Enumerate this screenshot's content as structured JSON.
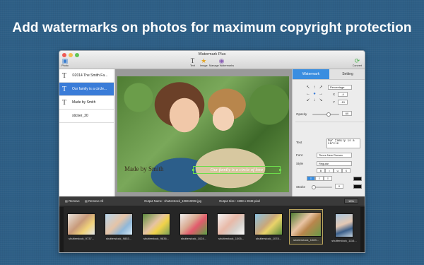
{
  "headline": "Add watermarks on photos for maximum copyright protection",
  "window": {
    "title": "Watermark Plus",
    "toolbar": {
      "photo_label": "Photo",
      "text_label": "Text",
      "image_label": "Image",
      "manage_label": "Manage Watermarks",
      "convert_label": "Convert"
    }
  },
  "layers": [
    {
      "label": "©2014 The Smith Fa...",
      "selected": false
    },
    {
      "label": "Our family is a circle...",
      "selected": true
    },
    {
      "label": "Made by Smith",
      "selected": false
    },
    {
      "label": "sticker_20",
      "selected": false
    }
  ],
  "layer_footer": {
    "stepper_value": "0"
  },
  "canvas": {
    "watermark_made_by": "Made by Smith",
    "watermark_family": "Our family is a circle of love"
  },
  "settings": {
    "tabs": [
      "Watermark",
      "Setting"
    ],
    "position_unit": "Percentage",
    "x_label": "X",
    "x_value": "-4",
    "y_label": "Y",
    "y_value": "-19",
    "opacity_label": "Opacity",
    "opacity_value": "60",
    "opacity_level": 0.6,
    "text_label": "Text",
    "text_value": "Our family is a circle",
    "font_label": "Font",
    "font_value": "Times New Roman",
    "style_label": "Style",
    "style_value": "Regular",
    "format_buttons": [
      "B",
      "I",
      "U",
      "S"
    ],
    "align_buttons": [
      "≡",
      "≡",
      "≡"
    ],
    "stroke_label": "Stroke",
    "stroke_value": "0",
    "colors": {
      "accent": "#3a8ee0",
      "selection": "#3a7cd8",
      "handle": "#6cdc4c"
    }
  },
  "statusbar": {
    "remove": "Remove",
    "remove_all": "Remove All",
    "output_name": "Output Name : shutterstock_108319002.jpg",
    "output_size": "Output Size : 4288 x 2848 pixel",
    "zoom": "15%"
  },
  "thumbnails": [
    {
      "label": "shutterstock_9737...",
      "selected": false
    },
    {
      "label": "shutterstock_9853...",
      "selected": false
    },
    {
      "label": "shutterstock_9836...",
      "selected": false
    },
    {
      "label": "shutterstock_1024...",
      "selected": false
    },
    {
      "label": "shutterstock_1005...",
      "selected": false
    },
    {
      "label": "shutterstock_1078...",
      "selected": false
    },
    {
      "label": "shutterstock_1083...",
      "selected": true
    },
    {
      "label": "shutterstock_1116...",
      "selected": false
    }
  ]
}
